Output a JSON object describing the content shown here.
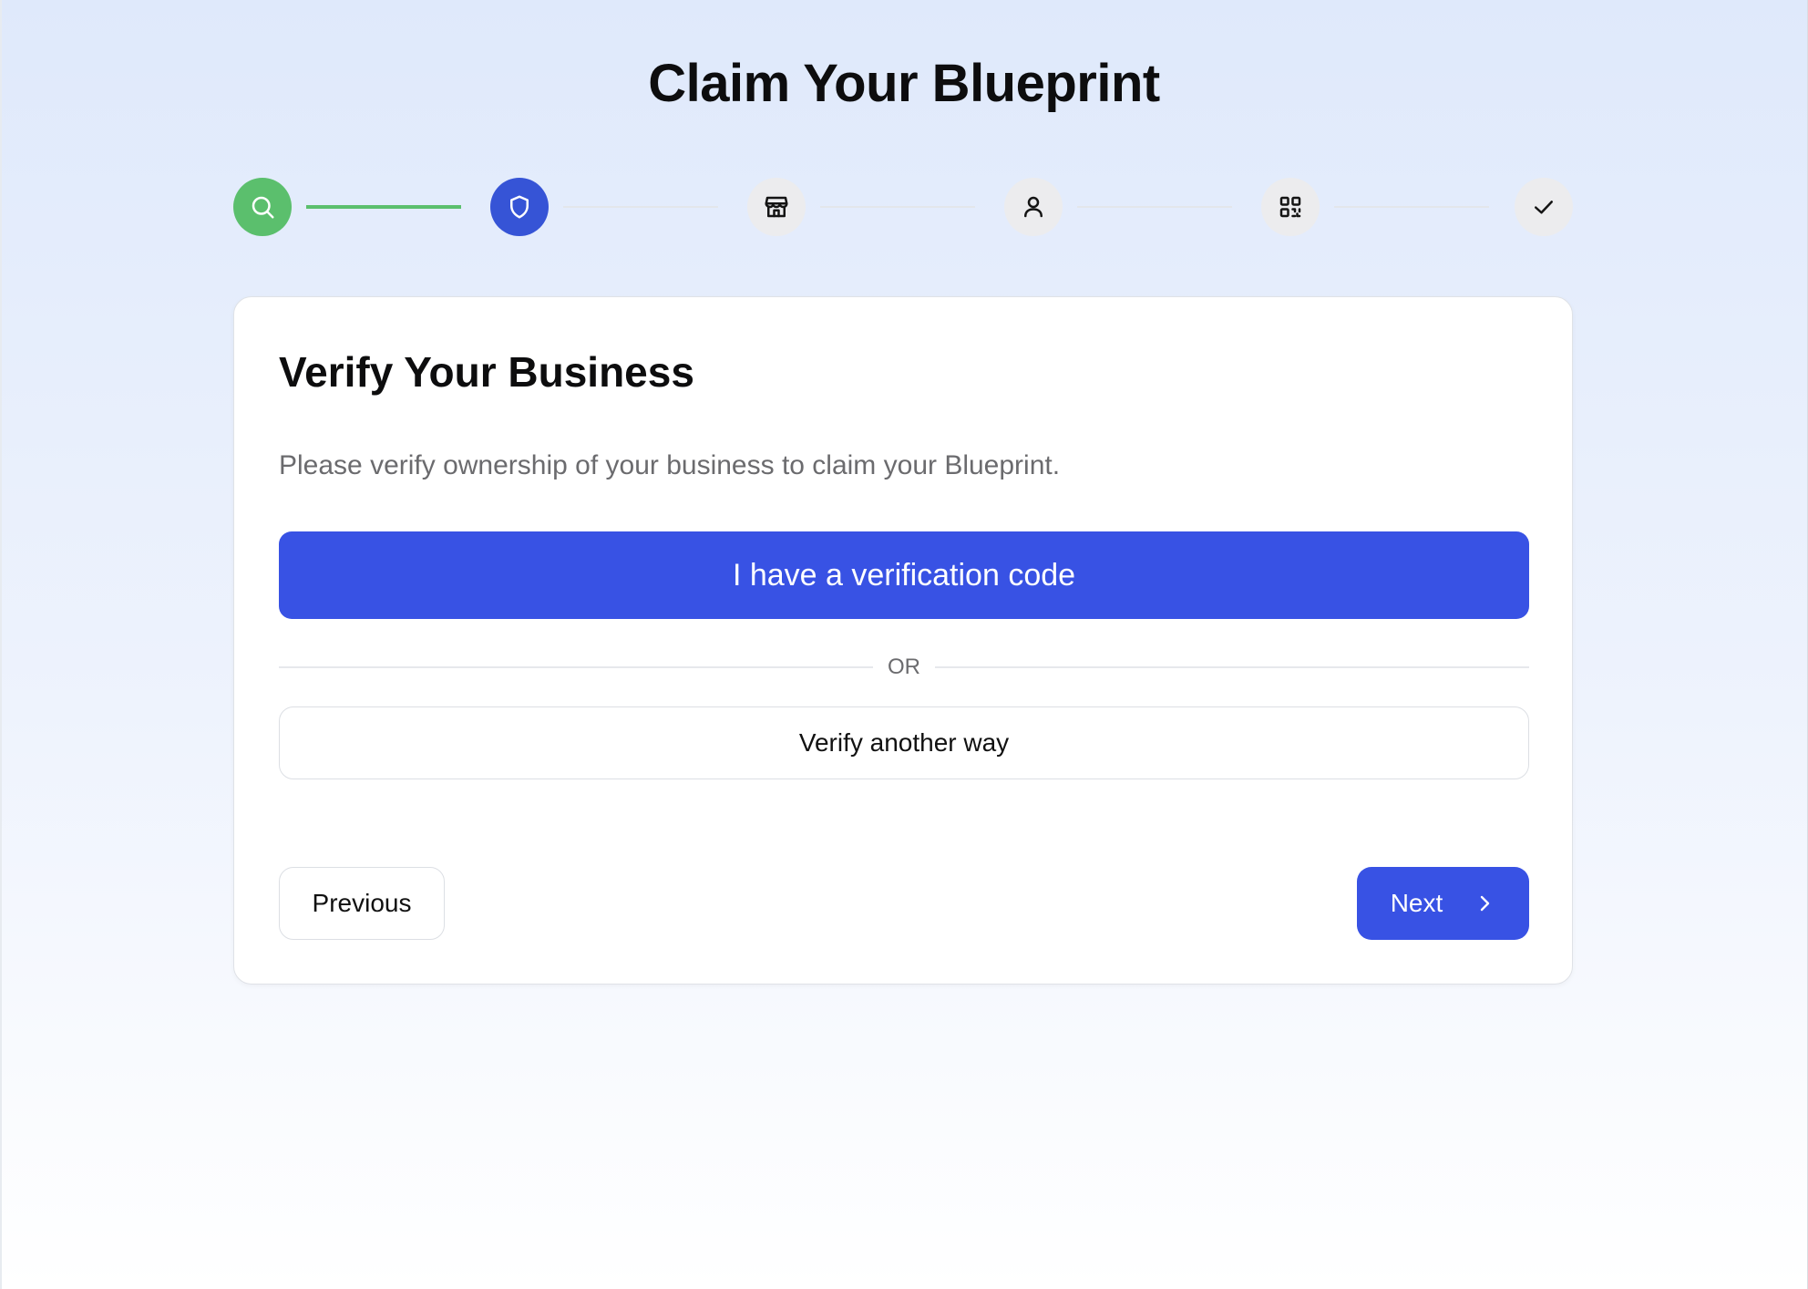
{
  "page": {
    "title": "Claim Your Blueprint"
  },
  "stepper": {
    "steps": [
      {
        "icon": "search-icon",
        "state": "done"
      },
      {
        "icon": "shield-icon",
        "state": "active"
      },
      {
        "icon": "store-icon",
        "state": "pending"
      },
      {
        "icon": "user-icon",
        "state": "pending"
      },
      {
        "icon": "qr-code-icon",
        "state": "pending"
      },
      {
        "icon": "check-icon",
        "state": "pending"
      }
    ],
    "colors": {
      "done": "#5bbf6d",
      "active": "#3654d6",
      "pending": "#ececee"
    }
  },
  "card": {
    "title": "Verify Your Business",
    "description": "Please verify ownership of your business to claim your Blueprint.",
    "primary_button": "I have a verification code",
    "divider_text": "OR",
    "secondary_button": "Verify another way",
    "previous_button": "Previous",
    "next_button": "Next"
  },
  "theme": {
    "accent": "#3852e4",
    "success": "#5bbf6d"
  }
}
